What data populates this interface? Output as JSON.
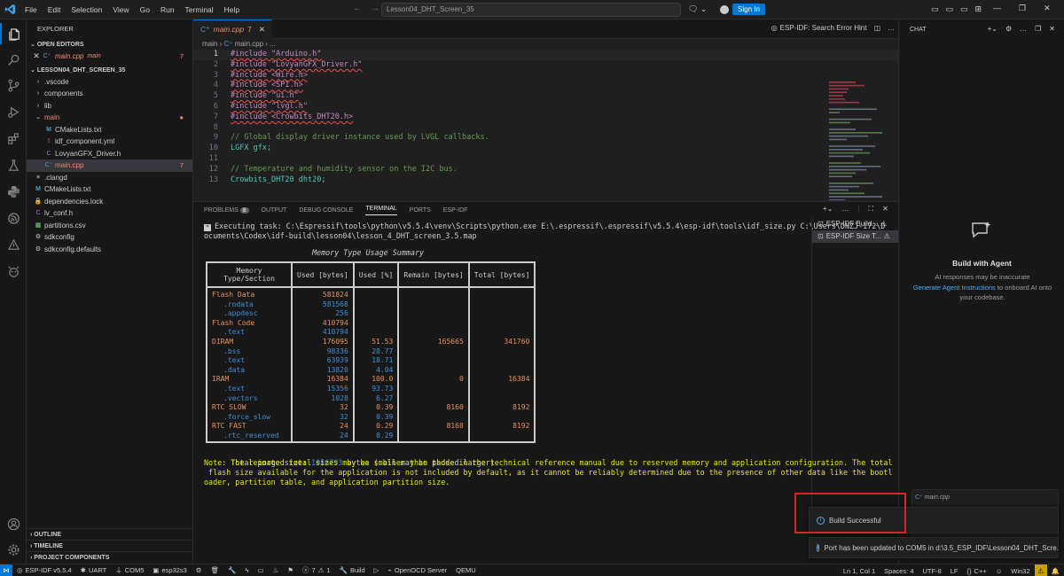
{
  "titlebar": {
    "menu": [
      "File",
      "Edit",
      "Selection",
      "View",
      "Go",
      "Run",
      "Terminal",
      "Help"
    ],
    "search_text": "Lesson04_DHT_Screen_35",
    "signin_label": "Sign In"
  },
  "explorer": {
    "title": "EXPLORER",
    "open_editors_label": "OPEN EDITORS",
    "open_editor_file": "main.cpp",
    "open_editor_folder": "main",
    "open_editor_count": "7",
    "project_label": "LESSON04_DHT_SCREEN_35",
    "tree": [
      {
        "name": ".vscode",
        "kind": "folder"
      },
      {
        "name": "components",
        "kind": "folder"
      },
      {
        "name": "lib",
        "kind": "folder"
      },
      {
        "name": "main",
        "kind": "folder-open"
      },
      {
        "name": "CMakeLists.txt",
        "kind": "cmake"
      },
      {
        "name": "idf_component.yml",
        "kind": "yml"
      },
      {
        "name": "LovyanGFX_Driver.h",
        "kind": "header"
      },
      {
        "name": "main.cpp",
        "kind": "cpp"
      },
      {
        "name": ".clangd",
        "kind": "file"
      },
      {
        "name": "CMakeLists.txt",
        "kind": "cmake"
      },
      {
        "name": "dependencies.lock",
        "kind": "lock"
      },
      {
        "name": "lv_conf.h",
        "kind": "header"
      },
      {
        "name": "partitions.csv",
        "kind": "csv"
      },
      {
        "name": "sdkconfig",
        "kind": "gear"
      },
      {
        "name": "sdkconfig.defaults",
        "kind": "gear"
      }
    ],
    "main_badge": "7",
    "outline_label": "OUTLINE",
    "timeline_label": "TIMELINE",
    "project_components_label": "PROJECT COMPONENTS"
  },
  "editor": {
    "tab_label": "main.cpp",
    "tab_count": "7",
    "search_hint": "ESP-IDF: Search Error Hint",
    "breadcrumb": [
      "main",
      "main.cpp",
      "..."
    ],
    "lines": [
      {
        "n": "1",
        "text": "#include \"Arduino.h\""
      },
      {
        "n": "2",
        "text": "#include \"LovyanGFX_Driver.h\""
      },
      {
        "n": "3",
        "text": "#include <Wire.h>"
      },
      {
        "n": "4",
        "text": "#include <SPI.h>"
      },
      {
        "n": "5",
        "text": "#include \"ui.h\""
      },
      {
        "n": "6",
        "text": "#include \"lvgl.h\""
      },
      {
        "n": "7",
        "text": "#include <Crowbits_DHT20.h>"
      },
      {
        "n": "8",
        "text": ""
      },
      {
        "n": "9",
        "text": "// Global display driver instance used by LVGL callbacks."
      },
      {
        "n": "10",
        "text": "LGFX gfx;"
      },
      {
        "n": "11",
        "text": ""
      },
      {
        "n": "12",
        "text": "// Temperature and humidity sensor on the I2C bus."
      },
      {
        "n": "13",
        "text": "Crowbits_DHT20 dht20;"
      }
    ]
  },
  "panel": {
    "tabs": [
      "PROBLEMS",
      "OUTPUT",
      "DEBUG CONSOLE",
      "TERMINAL",
      "PORTS",
      "ESP-IDF"
    ],
    "problems_count": "8",
    "exec_line1": "Executing task: C:\\Espressif\\tools\\python\\v5.5.4\\venv\\Scripts\\python.exe E:\\.espressif\\.espressif\\v5.5.4\\esp-idf\\tools\\idf_size.py C:\\Users\\DNZJ-172\\D",
    "exec_line2": "ocuments\\Codex\\idf-build\\lesson04\\lesson_4_DHT_screen_3.5.map",
    "table_title": "Memory Type Usage Summary",
    "table_headers": [
      "Memory Type/Section",
      "Used [bytes]",
      "Used [%]",
      "Remain [bytes]",
      "Total [bytes]"
    ],
    "table_rows": [
      {
        "name": "Flash Data",
        "level": 0,
        "used": "581824",
        "pct": "",
        "remain": "",
        "total": ""
      },
      {
        "name": ".rodata",
        "level": 1,
        "used": "581568",
        "pct": "",
        "remain": "",
        "total": ""
      },
      {
        "name": ".appdesc",
        "level": 1,
        "used": "256",
        "pct": "",
        "remain": "",
        "total": ""
      },
      {
        "name": "Flash Code",
        "level": 0,
        "used": "410794",
        "pct": "",
        "remain": "",
        "total": ""
      },
      {
        "name": ".text",
        "level": 1,
        "used": "410794",
        "pct": "",
        "remain": "",
        "total": ""
      },
      {
        "name": "DIRAM",
        "level": 0,
        "used": "176095",
        "pct": "51.53",
        "remain": "165665",
        "total": "341760"
      },
      {
        "name": ".bss",
        "level": 1,
        "used": "98336",
        "pct": "28.77",
        "remain": "",
        "total": ""
      },
      {
        "name": ".text",
        "level": 1,
        "used": "63939",
        "pct": "18.71",
        "remain": "",
        "total": ""
      },
      {
        "name": ".data",
        "level": 1,
        "used": "13820",
        "pct": "4.04",
        "remain": "",
        "total": ""
      },
      {
        "name": "IRAM",
        "level": 0,
        "used": "16384",
        "pct": "100.0",
        "remain": "0",
        "total": "16384"
      },
      {
        "name": ".text",
        "level": 1,
        "used": "15356",
        "pct": "93.73",
        "remain": "",
        "total": ""
      },
      {
        "name": ".vectors",
        "level": 1,
        "used": "1028",
        "pct": "6.27",
        "remain": "",
        "total": ""
      },
      {
        "name": "RTC SLOW",
        "level": 0,
        "used": "32",
        "pct": "0.39",
        "remain": "8160",
        "total": "8192"
      },
      {
        "name": ".force_slow",
        "level": 1,
        "used": "32",
        "pct": "0.39",
        "remain": "",
        "total": ""
      },
      {
        "name": "RTC FAST",
        "level": 0,
        "used": "24",
        "pct": "0.29",
        "remain": "8168",
        "total": "8192"
      },
      {
        "name": ".rtc_reserved",
        "level": 1,
        "used": "24",
        "pct": "0.29",
        "remain": "",
        "total": ""
      }
    ],
    "total_prefix": "Total image size: ",
    "total_value": "1086793",
    "total_suffix": " bytes (.bin may be padded larger)",
    "note_lines": [
      "Note: The reported total sizes may be smaller than those in the technical reference manual due to reserved memory and application configuration. The total",
      " flash size available for the application is not included by default, as it cannot be reliably determined due to the presence of other data like the bootl",
      "oader, partition table, and application partition size."
    ],
    "terminals": [
      "ESP-IDF Build...",
      "ESP-IDF Size T..."
    ]
  },
  "chat": {
    "title": "CHAT",
    "agent_title": "Build with Agent",
    "agent_text_1": "AI responses may be inaccurate",
    "agent_link": "Generate Agent Instructions",
    "agent_text_2": " to onboard AI onto your codebase.",
    "attachment": "main.cpp"
  },
  "notifications": {
    "build": "Build Successful",
    "port": "Port has been updated to COM5 in d:\\3.5_ESP_IDF\\Lesson04_DHT_Scre..."
  },
  "statusbar": {
    "esp_idf": "ESP-IDF v5.5.4",
    "uart": "UART",
    "com": "COM5",
    "target": "esp32s3",
    "errors": "7",
    "warnings": "1",
    "build": "Build",
    "openocd": "OpenOCD Server",
    "qemu": "QEMU",
    "position": "Ln 1, Col 1",
    "spaces": "Spaces: 4",
    "encoding": "UTF-8",
    "eol": "LF",
    "language": "C++",
    "platform": "Win32"
  },
  "colors": {
    "accent": "#0078d4",
    "warning_orange": "#e5915d",
    "info_blue": "#3d8fd6",
    "highlight_red": "#e0202a"
  }
}
